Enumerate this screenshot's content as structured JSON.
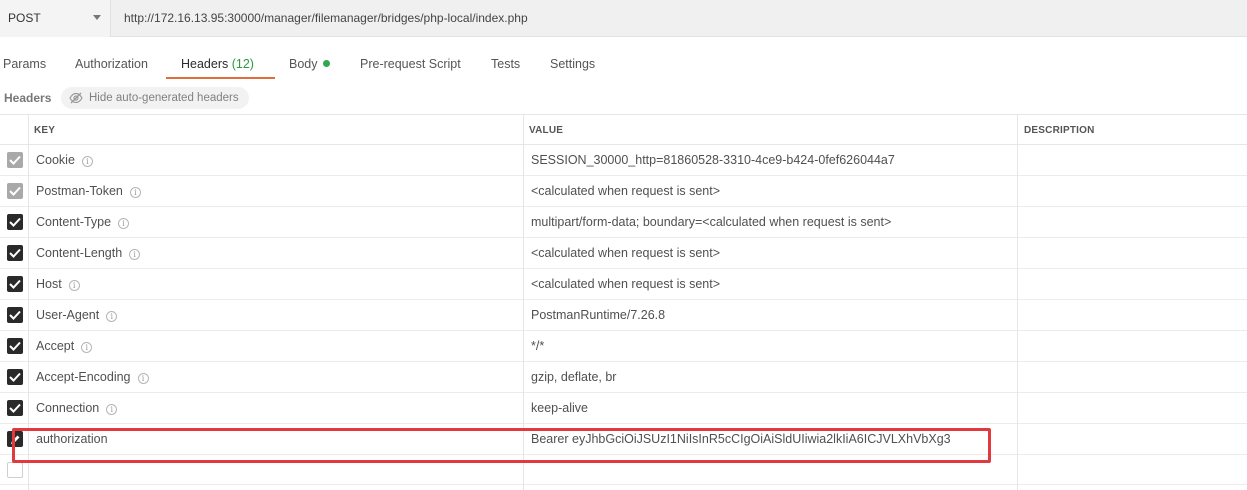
{
  "request": {
    "method": "POST",
    "url": "http://172.16.13.95:30000/manager/filemanager/bridges/php-local/index.php"
  },
  "tabs": [
    {
      "label": "Params"
    },
    {
      "label": "Authorization"
    },
    {
      "label": "Headers",
      "count": "(12)",
      "active": true
    },
    {
      "label": "Body",
      "has_content": true
    },
    {
      "label": "Pre-request Script"
    },
    {
      "label": "Tests"
    },
    {
      "label": "Settings"
    }
  ],
  "headers_section": {
    "title": "Headers",
    "hide_button_label": "Hide auto-generated headers"
  },
  "table": {
    "columns": [
      "KEY",
      "VALUE",
      "DESCRIPTION"
    ],
    "rows": [
      {
        "key": "Cookie",
        "value": "SESSION_30000_http=81860528-3310-4ce9-b424-0fef626044a7",
        "check": "auto",
        "info": true
      },
      {
        "key": "Postman-Token",
        "value": "<calculated when request is sent>",
        "check": "auto",
        "info": true
      },
      {
        "key": "Content-Type",
        "value": "multipart/form-data; boundary=<calculated when request is sent>",
        "check": "on",
        "info": true
      },
      {
        "key": "Content-Length",
        "value": "<calculated when request is sent>",
        "check": "on",
        "info": true
      },
      {
        "key": "Host",
        "value": "<calculated when request is sent>",
        "check": "on",
        "info": true
      },
      {
        "key": "User-Agent",
        "value": "PostmanRuntime/7.26.8",
        "check": "on",
        "info": true
      },
      {
        "key": "Accept",
        "value": "*/*",
        "check": "on",
        "info": true
      },
      {
        "key": "Accept-Encoding",
        "value": "gzip, deflate, br",
        "check": "on",
        "info": true
      },
      {
        "key": "Connection",
        "value": "keep-alive",
        "check": "on",
        "info": true
      },
      {
        "key": "authorization",
        "value": "Bearer eyJhbGciOiJSUzI1NiIsInR5cCIgOiAiSldUIiwia2lkIiA6ICJVLXhVbXg3",
        "check": "edit",
        "info": false
      },
      {
        "key": "",
        "value": "",
        "check": "off",
        "info": false
      }
    ]
  },
  "colors": {
    "active_tab_underline": "#e06e3b",
    "header_count": "#2e9a3e",
    "body_dot": "#2fa84f",
    "highlight_box": "#e0393e"
  }
}
